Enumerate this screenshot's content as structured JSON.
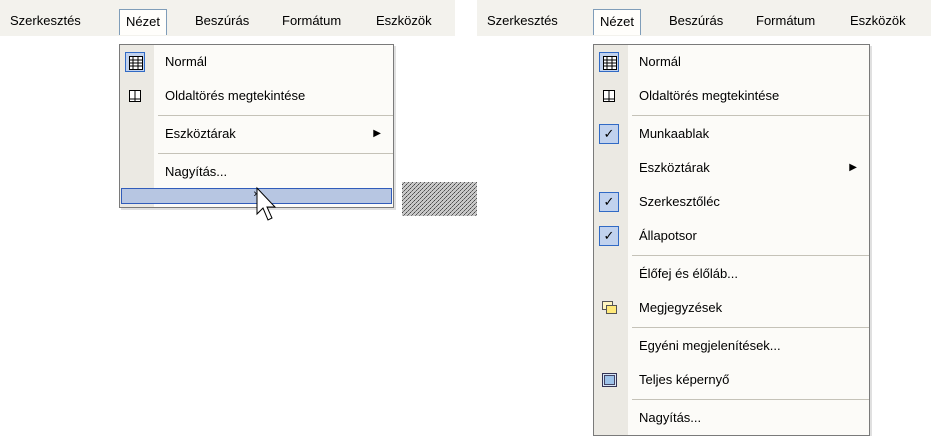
{
  "menubar": [
    "Szerkesztés",
    "Nézet",
    "Beszúrás",
    "Formátum",
    "Eszközök"
  ],
  "left_menu": {
    "items": [
      {
        "label": "Normál",
        "icon": "normal-view-icon"
      },
      {
        "label": "Oldaltörés megtekintése",
        "icon": "page-break-view-icon"
      },
      {
        "label": "Eszköztárak",
        "submenu": true
      },
      {
        "label": "Nagyítás..."
      }
    ],
    "expand": "»"
  },
  "right_menu": {
    "items": [
      {
        "label": "Normál",
        "icon": "normal-view-icon"
      },
      {
        "label": "Oldaltörés megtekintése",
        "icon": "page-break-view-icon"
      },
      {
        "label": "Munkaablak",
        "checked": true
      },
      {
        "label": "Eszköztárak",
        "submenu": true
      },
      {
        "label": "Szerkesztőléc",
        "checked": true
      },
      {
        "label": "Állapotsor",
        "checked": true
      },
      {
        "label": "Élőfej és élőláb..."
      },
      {
        "label": "Megjegyzések",
        "icon": "comments-icon"
      },
      {
        "label": "Egyéni megjelenítések..."
      },
      {
        "label": "Teljes képernyő",
        "icon": "full-screen-icon"
      },
      {
        "label": "Nagyítás..."
      }
    ]
  },
  "glyphs": {
    "checkmark": "✓",
    "submenu_arrow": "▶"
  }
}
